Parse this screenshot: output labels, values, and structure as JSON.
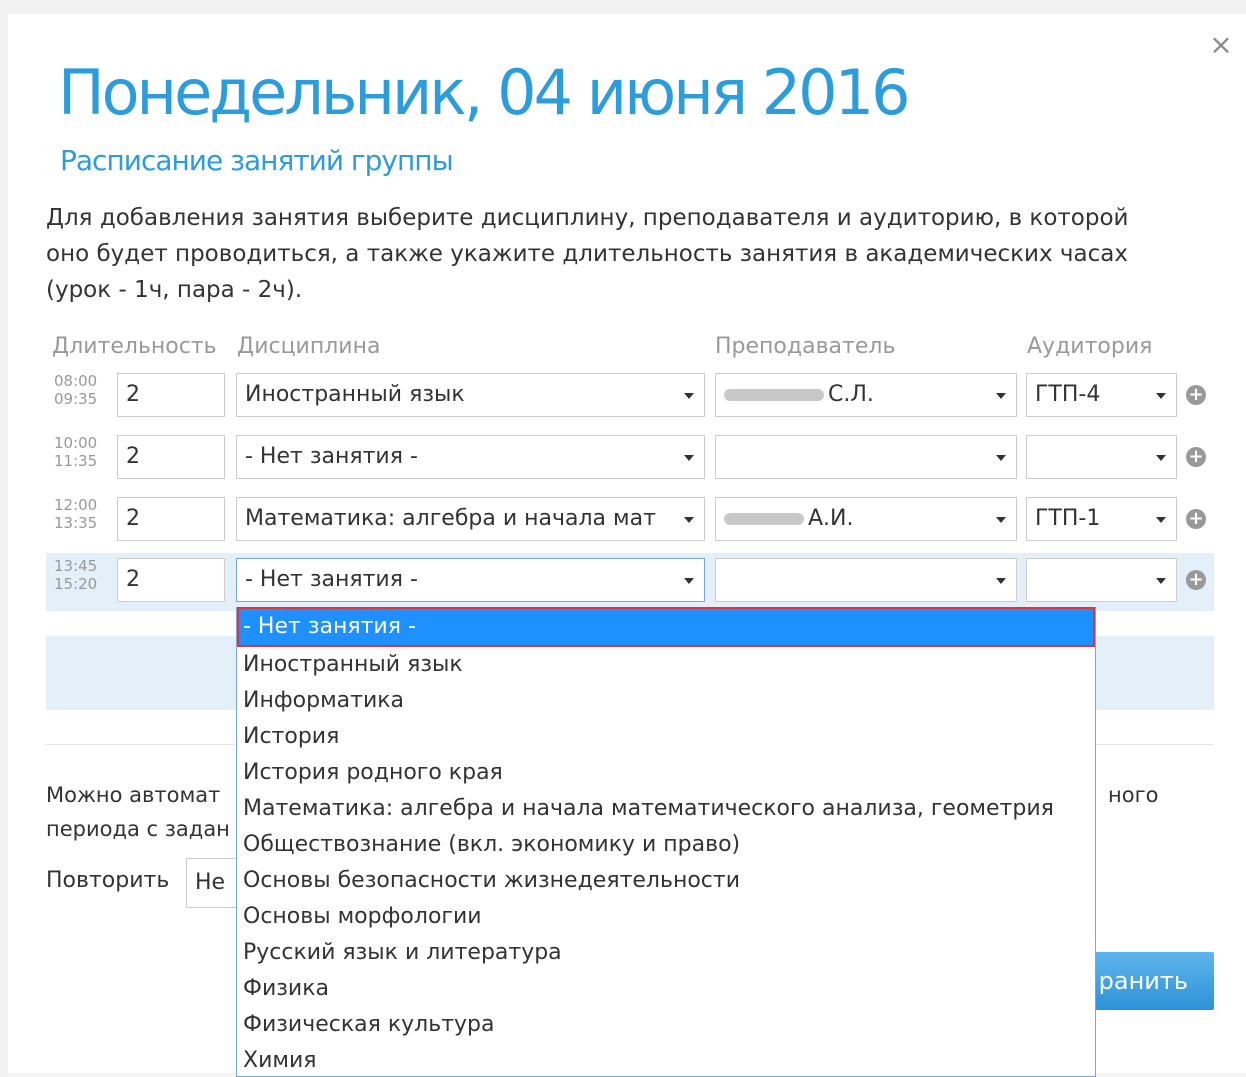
{
  "modal": {
    "close_label": "×",
    "title": "Понедельник, 04 июня 2016",
    "subtitle": "Расписание занятий группы",
    "description": "Для добавления занятия выберите дисциплину, преподавателя и аудиторию, в которой оно будет проводиться, а также укажите длительность занятия в академических часах (урок - 1ч, пара - 2ч)."
  },
  "headers": {
    "duration": "Длительность",
    "discipline": "Дисциплина",
    "teacher": "Преподаватель",
    "room": "Аудитория"
  },
  "rows": [
    {
      "time_start": "08:00",
      "time_end": "09:35",
      "duration": "2",
      "discipline": "Иностранный язык",
      "teacher": "С.Л.",
      "room": "ГТП-4"
    },
    {
      "time_start": "10:00",
      "time_end": "11:35",
      "duration": "2",
      "discipline": "- Нет занятия -",
      "teacher": "",
      "room": ""
    },
    {
      "time_start": "12:00",
      "time_end": "13:35",
      "duration": "2",
      "discipline": "Математика: алгебра и начала мат",
      "teacher": "А.И.",
      "room": "ГТП-1"
    },
    {
      "time_start": "13:45",
      "time_end": "15:20",
      "duration": "2",
      "discipline": "- Нет занятия -",
      "teacher": "",
      "room": ""
    }
  ],
  "auto": {
    "text_start": "Можно автомат",
    "text_end": "ного",
    "text_line2": "периода с задан",
    "repeat_label": "Повторить",
    "repeat_value": "Не"
  },
  "save_label": "ранить",
  "dropdown": {
    "options": [
      "- Нет занятия -",
      "Иностранный язык",
      "Информатика",
      "История",
      "История родного края",
      "Математика: алгебра и начала математического анализа, геометрия",
      "Обществознание (вкл. экономику и право)",
      "Основы безопасности жизнедеятельности",
      "Основы морфологии",
      "Русский язык и литература",
      "Физика",
      "Физическая культура",
      "Химия"
    ]
  },
  "colors": {
    "accent": "#2d9cdb",
    "selected_option": "#1e90ff",
    "highlight_border": "#d9363e",
    "active_row": "#e3f0fa"
  }
}
